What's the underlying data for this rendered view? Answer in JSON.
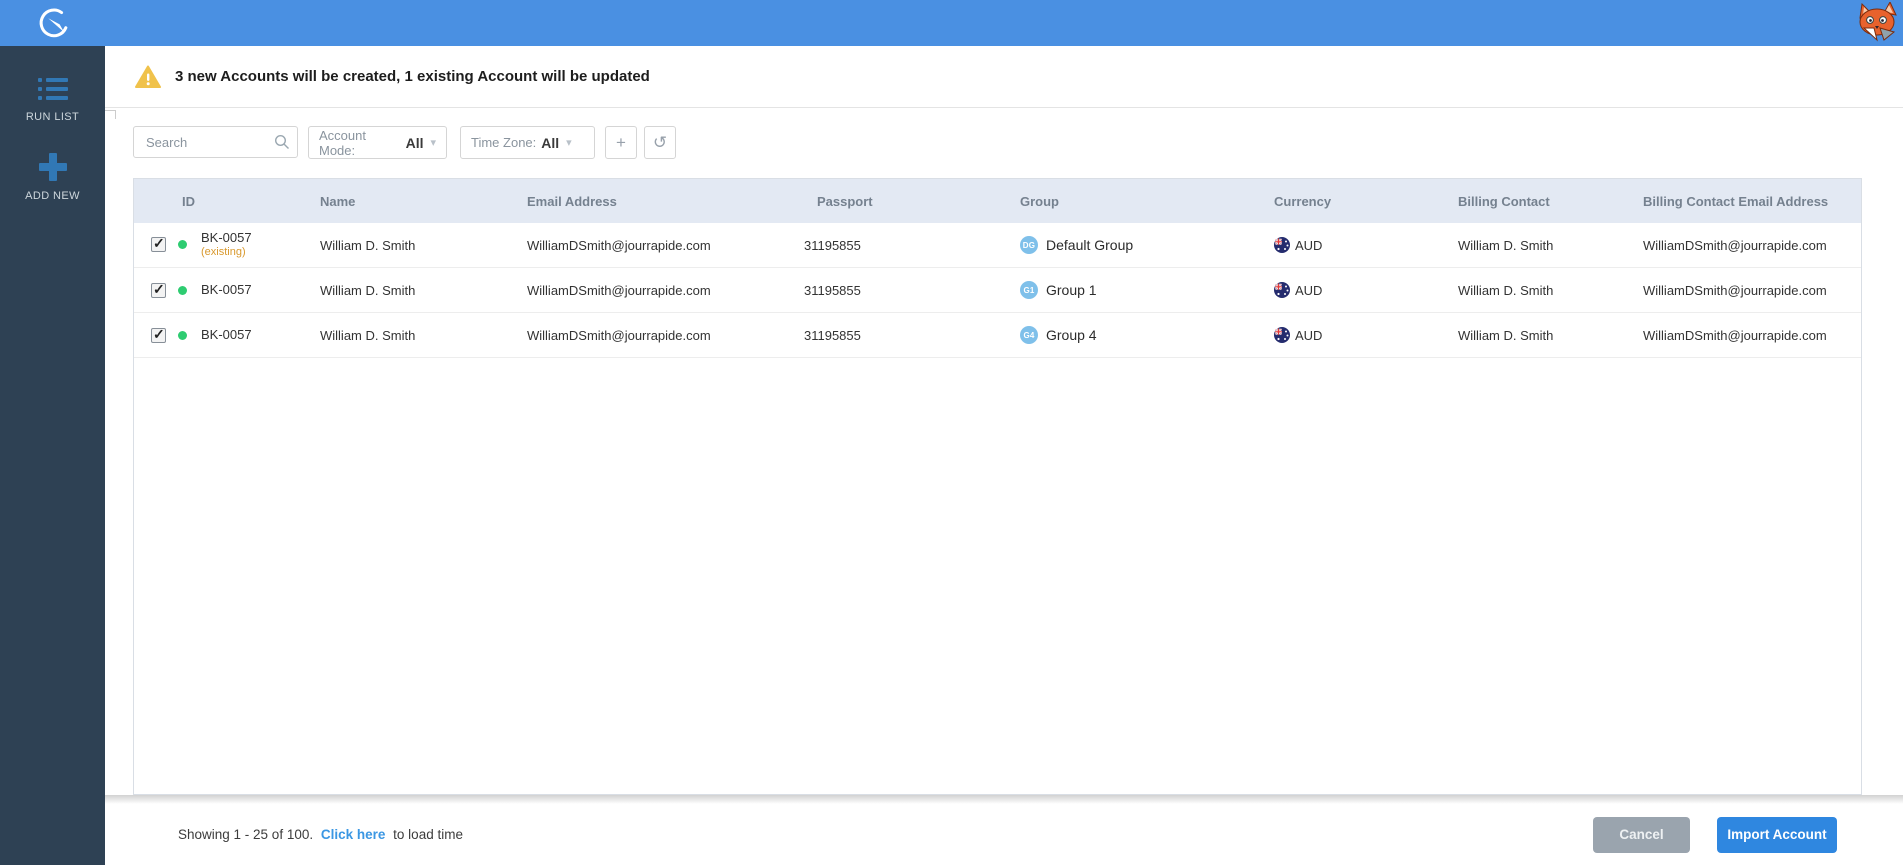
{
  "colors": {
    "topbar_blue": "#4a90e2",
    "sidebar_navy": "#2e4154",
    "sidebar_icon_blue": "#3178b5",
    "warning_amber": "#f0c24b",
    "status_green": "#2ecc71",
    "existing_orange": "#d9992e",
    "header_bg": "#e3e9f3",
    "badge_blue": "#7fc0ea",
    "link_blue": "#3b97e3",
    "cancel_gray": "#9aa4ae",
    "import_blue": "#2f87e0"
  },
  "sidebar": {
    "items": [
      {
        "label": "RUN LIST",
        "icon": "run-list-icon"
      },
      {
        "label": "ADD NEW",
        "icon": "add-new-plus-icon"
      }
    ]
  },
  "warning": {
    "icon": "warning-triangle-icon",
    "text": "3 new Accounts will be created, 1 existing Account will be updated"
  },
  "filters": {
    "search_placeholder": "Search",
    "search_icon": "magnifier-icon",
    "account_mode_label": "Account Mode:",
    "account_mode_value": "All",
    "time_zone_label": "Time Zone:",
    "time_zone_value": "All",
    "chevron_glyph": "▾",
    "add_glyph": "+",
    "reset_glyph": "↺"
  },
  "table": {
    "columns": [
      "ID",
      "Name",
      "Email Address",
      "Passport",
      "Group",
      "Currency",
      "Billing Contact",
      "Billing Contact Email Address"
    ],
    "rows": [
      {
        "checked": true,
        "status": "green",
        "id": "BK-0057",
        "id_note": "(existing)",
        "name": "William D. Smith",
        "email": "WilliamDSmith@jourrapide.com",
        "passport": "31195855",
        "group_badge": "DG",
        "group": "Default Group",
        "currency": "AUD",
        "billing_contact": "William D. Smith",
        "billing_email": "WilliamDSmith@jourrapide.com"
      },
      {
        "checked": true,
        "status": "green",
        "id": "BK-0057",
        "id_note": "",
        "name": "William D. Smith",
        "email": "WilliamDSmith@jourrapide.com",
        "passport": "31195855",
        "group_badge": "G1",
        "group": "Group 1",
        "currency": "AUD",
        "billing_contact": "William D. Smith",
        "billing_email": "WilliamDSmith@jourrapide.com"
      },
      {
        "checked": true,
        "status": "green",
        "id": "BK-0057",
        "id_note": "",
        "name": "William D. Smith",
        "email": "WilliamDSmith@jourrapide.com",
        "passport": "31195855",
        "group_badge": "G4",
        "group": "Group 4",
        "currency": "AUD",
        "billing_contact": "William D. Smith",
        "billing_email": "WilliamDSmith@jourrapide.com"
      }
    ]
  },
  "footer": {
    "showing_text": "Showing 1 - 25 of 100.",
    "link_text": "Click here",
    "suffix_text": "to load time",
    "cancel_label": "Cancel",
    "import_label": "Import Account"
  }
}
